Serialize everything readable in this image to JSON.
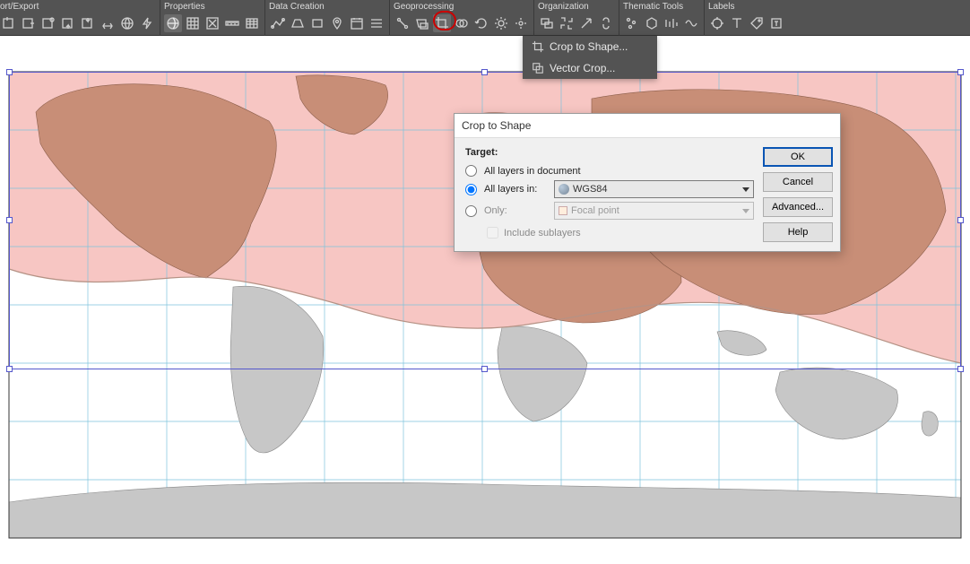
{
  "toolbar": {
    "groups": [
      {
        "label": "ort/Export"
      },
      {
        "label": "Properties"
      },
      {
        "label": "Data Creation"
      },
      {
        "label": "Geoprocessing"
      },
      {
        "label": "Organization"
      },
      {
        "label": "Thematic Tools"
      },
      {
        "label": "Labels"
      }
    ]
  },
  "dropdown": {
    "item1": "Crop to Shape...",
    "item2": "Vector Crop..."
  },
  "dialog": {
    "title": "Crop to Shape",
    "target_label": "Target:",
    "radio_all_layers": "All layers in document",
    "radio_all_layers_in": "All layers in:",
    "radio_only": "Only:",
    "select_value": "WGS84",
    "select_disabled_value": "Focal point",
    "include_sublayers": "Include sublayers",
    "buttons": {
      "ok": "OK",
      "cancel": "Cancel",
      "advanced": "Advanced...",
      "help": "Help"
    }
  }
}
